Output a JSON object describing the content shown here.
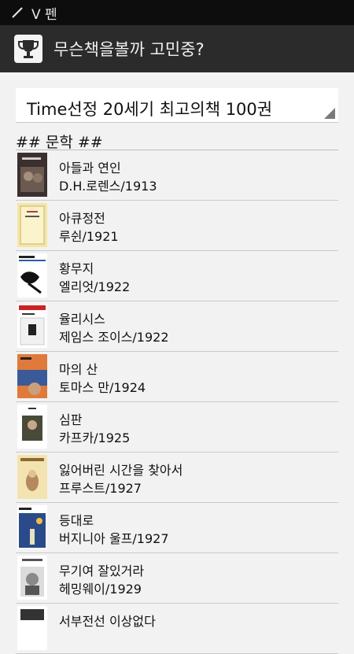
{
  "statusbar": {
    "text": "V 펜",
    "icon": "pen-icon"
  },
  "actionbar": {
    "title": "무슨책을볼까 고민중?",
    "icon": "trophy-icon"
  },
  "spinner": {
    "selected": "Time선정 20세기 최고의책 100권"
  },
  "section": {
    "header": "## 문학 ##"
  },
  "books": [
    {
      "title": "아들과 연인",
      "sub": "D.H.로렌스/1913"
    },
    {
      "title": "아큐정전",
      "sub": "루쉰/1921"
    },
    {
      "title": "황무지",
      "sub": "엘리엇/1922"
    },
    {
      "title": "율리시스",
      "sub": "제임스 조이스/1922"
    },
    {
      "title": "마의 산",
      "sub": "토마스 만/1924"
    },
    {
      "title": "심판",
      "sub": "카프카/1925"
    },
    {
      "title": "잃어버린 시간을 찾아서",
      "sub": "프루스트/1927"
    },
    {
      "title": "등대로",
      "sub": "버지니아 울프/1927"
    },
    {
      "title": "무기여 잘있거라",
      "sub": "헤밍웨이/1929"
    },
    {
      "title": "서부전선 이상없다",
      "sub": ""
    }
  ]
}
